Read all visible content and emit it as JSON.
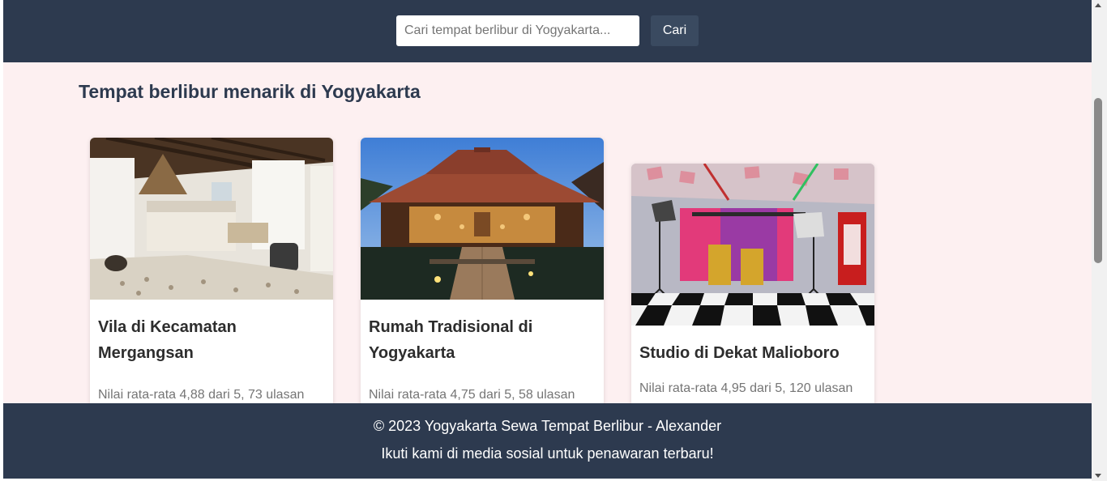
{
  "search": {
    "placeholder": "Cari tempat berlibur di Yogyakarta...",
    "button_label": "Cari"
  },
  "main": {
    "title": "Tempat berlibur menarik di Yogyakarta",
    "cards": [
      {
        "title": "Vila di Kecamatan Mergangsan",
        "rating": "Nilai rata-rata 4,88 dari 5, 73 ulasan"
      },
      {
        "title": "Rumah Tradisional di Yogyakarta",
        "rating": "Nilai rata-rata 4,75 dari 5, 58 ulasan"
      },
      {
        "title": "Studio di Dekat Malioboro",
        "rating": "Nilai rata-rata 4,95 dari 5, 120 ulasan"
      }
    ]
  },
  "footer": {
    "copyright": "© 2023 Yogyakarta Sewa Tempat Berlibur - Alexander",
    "social": "Ikuti kami di media sosial untuk penawaran terbaru!"
  }
}
